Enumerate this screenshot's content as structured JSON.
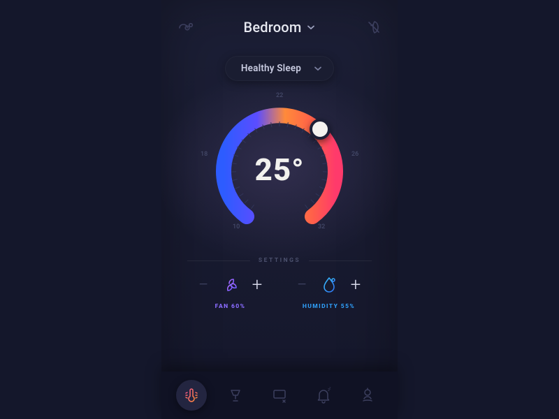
{
  "header": {
    "room_label": "Bedroom"
  },
  "mode": {
    "label": "Healthy Sleep"
  },
  "dial": {
    "temperature_display": "25°",
    "scale": {
      "min": 10,
      "max": 32,
      "labels": [
        "10",
        "18",
        "22",
        "26",
        "32"
      ]
    }
  },
  "settings": {
    "title": "SETTINGS",
    "fan": {
      "label": "FAN 60%",
      "color": "#8a6cff"
    },
    "humidity": {
      "label": "HUMIDITY 55%",
      "color": "#2f9cf4"
    }
  },
  "nav": {
    "items": [
      "temperature",
      "lighting",
      "display",
      "alarm",
      "scene"
    ],
    "active_index": 0
  },
  "colors": {
    "arc_cold": "#2d5cff",
    "arc_warm": "#ff7a3d",
    "arc_mid": "#ff5f4a",
    "arc_hot": "#ff3a6b"
  }
}
